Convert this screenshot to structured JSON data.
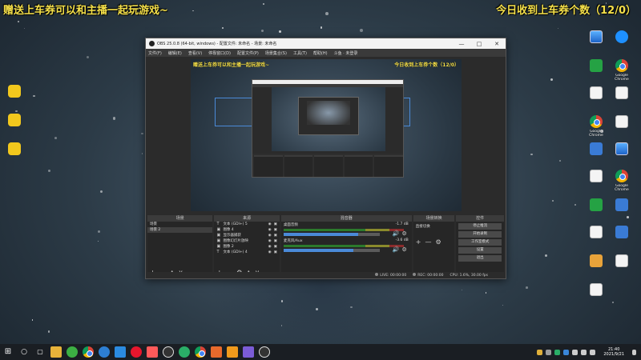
{
  "overlay": {
    "left_text": "赠送上车券可以和主播一起玩游戏~",
    "right_text": "今日收到上车券个数（12/0）",
    "color": "#f5e04a"
  },
  "desktop_left": [
    {
      "label": "",
      "icon": "yellow-app-icon"
    },
    {
      "label": "",
      "icon": "yellow-app-icon"
    },
    {
      "label": "",
      "icon": "yellow-app-icon"
    }
  ],
  "desktop_right": [
    {
      "label": "",
      "icon": "pc-icon"
    },
    {
      "label": "",
      "icon": "ie-icon"
    },
    {
      "label": "",
      "icon": "green-app-icon"
    },
    {
      "label": "Google Chrome",
      "icon": "chrome-icon"
    },
    {
      "label": "",
      "icon": "doc-icon"
    },
    {
      "label": "",
      "icon": "doc-icon"
    },
    {
      "label": "Google Chrome",
      "icon": "chrome-icon"
    },
    {
      "label": "",
      "icon": "doc-icon"
    },
    {
      "label": "",
      "icon": "app-icon"
    },
    {
      "label": "",
      "icon": "app-icon"
    },
    {
      "label": "",
      "icon": "doc-icon"
    },
    {
      "label": "Google Chrome",
      "icon": "chrome-icon"
    },
    {
      "label": "",
      "icon": "green-app-icon"
    },
    {
      "label": "",
      "icon": "blue-app-icon"
    },
    {
      "label": "",
      "icon": "doc-icon"
    },
    {
      "label": "",
      "icon": "blue-app-icon"
    },
    {
      "label": "",
      "icon": "orange-app-icon"
    },
    {
      "label": "",
      "icon": "app-icon"
    },
    {
      "label": "",
      "icon": "doc-icon"
    }
  ],
  "obs": {
    "title": "OBS 25.0.8 (64-bit, windows) - 配置文件: 未命名 - 场景: 未命名",
    "menu": [
      "文件(F)",
      "编辑(E)",
      "查看(V)",
      "停靠窗口(D)",
      "配置文件(P)",
      "场景集合(S)",
      "工具(T)",
      "帮助(H)",
      "斗鱼 · 未登录"
    ],
    "preview_left_text": "赠送上车券可以和主播一起玩游戏~",
    "preview_right_text": "今日收到上车券个数（12/0）",
    "docks": {
      "scenes": {
        "title": "场景",
        "items": [
          "场景",
          "场景 2"
        ]
      },
      "sources": {
        "title": "来源",
        "items": [
          {
            "type": "T",
            "label": "文本 (GDI+) 5"
          },
          {
            "type": "▣",
            "label": "图像 4"
          },
          {
            "type": "▣",
            "label": "显示器捕获"
          },
          {
            "type": "▣",
            "label": "图像幻灯片放映"
          },
          {
            "type": "▣",
            "label": "图像 2"
          },
          {
            "type": "T",
            "label": "文本 (GDI+) 4"
          }
        ]
      },
      "mixer": {
        "title": "混音器",
        "tracks": [
          {
            "name": "桌面音频",
            "db": "-1.7 dB",
            "level": 0.78
          },
          {
            "name": "麦克风/Aux",
            "db": "-3.6 dB",
            "level": 0.73
          }
        ]
      },
      "transitions": {
        "title": "场景转换",
        "mode": "直接切换"
      },
      "controls": {
        "title": "控件",
        "buttons": [
          "停止推流",
          "开始录制",
          "工作室模式",
          "设置",
          "退出"
        ]
      }
    },
    "status": {
      "live": "LIVE: 00:00:00",
      "rec": "REC: 00:00:00",
      "cpu": "CPU: 1.6%, 30.00 fps"
    }
  },
  "clock": {
    "time": "21:40",
    "date": "2021/9/21"
  },
  "taskbar_icons": [
    "windows-icon",
    "search-icon",
    "task-view-icon",
    "folder-icon",
    "green-app-icon",
    "chrome-icon",
    "edge-icon",
    "app-icon",
    "weibo-icon",
    "app-icon",
    "obs-icon",
    "wechat-icon",
    "chrome-icon",
    "app-icon",
    "orange-app-icon",
    "app-icon",
    "obs-icon"
  ]
}
